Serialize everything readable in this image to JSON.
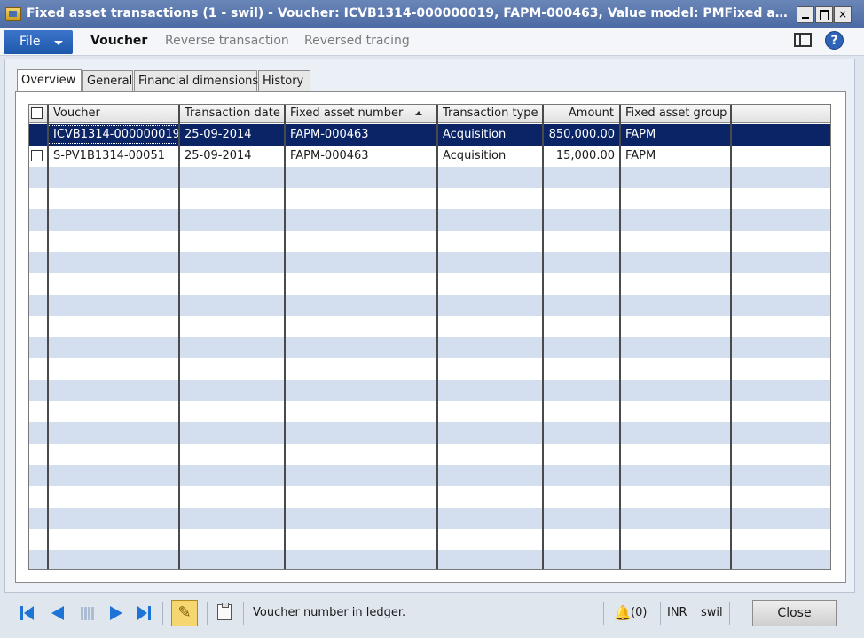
{
  "window": {
    "title": "Fixed asset transactions (1 - swil) - Voucher: ICVB1314-000000019, FAPM-000463, Value model: PMFixed asset numbe...",
    "minimize": "_",
    "maximize": "□",
    "close": "×"
  },
  "ribbon": {
    "file_label": "File",
    "tabs": [
      "Voucher",
      "Reverse transaction",
      "Reversed tracing"
    ]
  },
  "tabs": [
    "Overview",
    "General",
    "Financial dimensions",
    "History"
  ],
  "grid": {
    "columns": [
      "Voucher",
      "Transaction date",
      "Fixed asset number",
      "Transaction type",
      "Amount",
      "Fixed asset group"
    ],
    "rows": [
      {
        "voucher": "ICVB1314-000000019",
        "date": "25-09-2014",
        "asset": "FAPM-000463",
        "type": "Acquisition",
        "amount": "850,000.00",
        "group": "FAPM"
      },
      {
        "voucher": "S-PV1B1314-00051",
        "date": "25-09-2014",
        "asset": "FAPM-000463",
        "type": "Acquisition",
        "amount": "15,000.00",
        "group": "FAPM"
      }
    ]
  },
  "status": {
    "help_text": "Voucher number in ledger.",
    "notifications": "(0)",
    "currency": "INR",
    "company": "swil",
    "close_label": "Close"
  },
  "help_icon": "?",
  "edit_icon": "✎",
  "bell_icon": "🔔"
}
